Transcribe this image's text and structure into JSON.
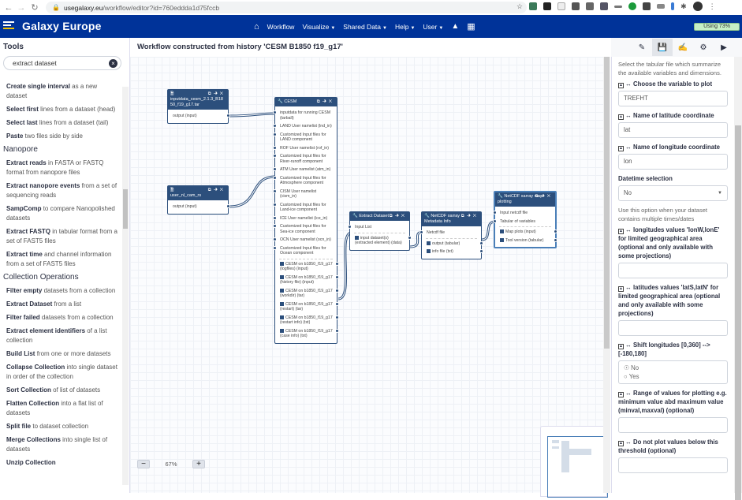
{
  "browser": {
    "url_host": "usegalaxy.eu",
    "url_path": "/workflow/editor?id=760eddda1d75fccb"
  },
  "masthead": {
    "brand": "Galaxy Europe",
    "nav": [
      {
        "label": "Workflow",
        "dropdown": false
      },
      {
        "label": "Visualize",
        "dropdown": true
      },
      {
        "label": "Shared Data",
        "dropdown": true
      },
      {
        "label": "Help",
        "dropdown": true
      },
      {
        "label": "User",
        "dropdown": true
      }
    ],
    "quota_label": "Using 73%",
    "quota_percent": 73
  },
  "tools": {
    "title": "Tools",
    "search_value": "extract dataset",
    "sections": [
      {
        "title": "",
        "items": [
          {
            "name": "Create single interval",
            "desc": "as a new dataset"
          },
          {
            "name": "Select first",
            "desc": "lines from a dataset (head)"
          },
          {
            "name": "Select last",
            "desc": "lines from a dataset (tail)"
          },
          {
            "name": "Paste",
            "desc": "two files side by side"
          }
        ]
      },
      {
        "title": "Nanopore",
        "items": [
          {
            "name": "Extract reads",
            "desc": "in FASTA or FASTQ format from nanopore files"
          },
          {
            "name": "Extract nanopore events",
            "desc": "from a set of sequencing reads"
          },
          {
            "name": "SampComp",
            "desc": "to compare Nanopolished datasets"
          },
          {
            "name": "Extract FASTQ",
            "desc": "in tabular format from a set of FAST5 files"
          },
          {
            "name": "Extract time",
            "desc": "and channel information from a set of FAST5 files"
          }
        ]
      },
      {
        "title": "Collection Operations",
        "items": [
          {
            "name": "Filter empty",
            "desc": "datasets from a collection"
          },
          {
            "name": "Extract Dataset",
            "desc": "from a list"
          },
          {
            "name": "Filter failed",
            "desc": "datasets from a collection"
          },
          {
            "name": "Extract element identifiers",
            "desc": "of a list collection"
          },
          {
            "name": "Build List",
            "desc": "from one or more datasets"
          },
          {
            "name": "Collapse Collection",
            "desc": "into single dataset in order of the collection"
          },
          {
            "name": "Sort Collection",
            "desc": "of list of datasets"
          },
          {
            "name": "Flatten Collection",
            "desc": "into a flat list of datasets"
          },
          {
            "name": "Split file",
            "desc": "to dataset collection"
          },
          {
            "name": "Merge Collections",
            "desc": "into single list of datasets"
          },
          {
            "name": "Unzip Collection",
            "desc": ""
          }
        ]
      }
    ]
  },
  "workflow": {
    "title": "Workflow constructed from history 'CESM B1850 f19_g17'",
    "zoom_label": "67%",
    "nodes": {
      "input1": {
        "title": "inputdata_cesm_2.1.3_B1850_f19_g17.tar",
        "outputs": [
          "output (input)"
        ]
      },
      "input2": {
        "title": "user_nl_cam_rs",
        "outputs": [
          "output (input)"
        ]
      },
      "cesm": {
        "title": "CESM",
        "inputs": [
          "inputdata for running CESM (tarball)",
          "LAND User namelist (lnd_in)",
          "Customized Input files for LAND component",
          "ROF User namelist (rof_in)",
          "Customized Input files for River-runoff component",
          "ATM User namelist (atm_in)",
          "Customized Input files for Atmosphere component",
          "CISM User namelist (cism_in)",
          "Customized Input files for Land-ice component",
          "ICE User namelist (ice_in)",
          "Customized Input files for Sea-ice component",
          "OCN User namelist (ocn_in)",
          "Customized Input files for Ocean component"
        ],
        "outputs": [
          "CESM on b1850_f19_g17 (logfiles) (input)",
          "CESM on b1850_f19_g17 (history file) (input)",
          "CESM on b1850_f19_g17 (workdir) (tar)",
          "CESM on b1850_f19_g17 (restart) (tar)",
          "CESM on b1850_f19_g17 (restart info) (txt)",
          "CESM on b1850_f19_g17 (case info) (txt)"
        ]
      },
      "extract": {
        "title": "Extract Dataset",
        "inputs": [
          "Input List"
        ],
        "outputs": [
          "input dataset(s) (extracted element) (data)"
        ]
      },
      "meta": {
        "title": "NetCDF xarray Metadata Info",
        "inputs": [
          "Netcdf file"
        ],
        "outputs": [
          "output (tabular)",
          "info file (txt)"
        ]
      },
      "plot": {
        "title": "NetCDF xarray map plotting",
        "inputs": [
          "Input netcdf file",
          "Tabular of variables"
        ],
        "outputs": [
          "Map plots (input)",
          "Tool version (tabular)"
        ]
      }
    }
  },
  "params": {
    "help_top": "Select the tabular file which summarize the available variables and dimensions.",
    "variable_label": "Choose the variable to plot",
    "variable_value": "TREFHT",
    "lat_label": "Name of latitude coordinate",
    "lat_value": "lat",
    "lon_label": "Name of longitude coordinate",
    "lon_value": "lon",
    "datetime_label": "Datetime selection",
    "datetime_value": "No",
    "datetime_help": "Use this option when your dataset contains multiple times/dates",
    "lonrange_label": "longitudes values 'lonW,lonE' for limited geographical area (optional and only available with some projections)",
    "lonrange_value": "",
    "latrange_label": "latitudes values 'latS,latN' for limited geographical area (optional and only available with some projections)",
    "latrange_value": "",
    "shift_label": "Shift longitudes [0,360] --> [-180,180]",
    "shift_options": [
      "No",
      "Yes"
    ],
    "shift_selected": "No",
    "range_label": "Range of values for plotting e.g. minimum value abd maximum value (minval,maxval) (optional)",
    "range_value": "",
    "threshold_label": "Do not plot values below this threshold (optional)",
    "threshold_value": ""
  }
}
